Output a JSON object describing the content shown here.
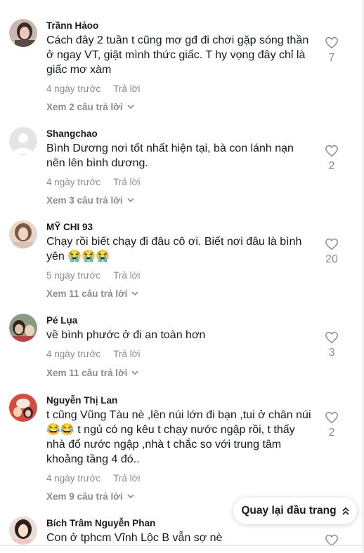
{
  "comments": [
    {
      "username": "Trầnn Hảoo",
      "text": "Cách đây 2 tuần t cũng mơ gđ đi chơi gặp sóng thần ở ngay VT, giật mình thức giấc. T hy vọng đây chỉ là giấc mơ xàm",
      "time": "4 ngày trước",
      "reply": "Trả lời",
      "view_replies": "Xem 2 câu trả lời",
      "likes": "7"
    },
    {
      "username": "Shangchao",
      "text": "Bình Dương nơi tốt nhất hiện tại, bà con lánh nạn nên lên bình dương.",
      "time": "4 ngày trước",
      "reply": "Trả lời",
      "view_replies": "Xem 3 câu trả lời",
      "likes": "2"
    },
    {
      "username": "MỸ CHI 93",
      "text": "Chạy rồi biết chạy đi đâu cô ơi. Biết nơi đâu là bình yên 😭😭😭",
      "time": "5 ngày trước",
      "reply": "Trả lời",
      "view_replies": "Xem 11 câu trả lời",
      "likes": "20"
    },
    {
      "username": "Pé Lụa",
      "text": "về bình phước ở đi an toàn hơn",
      "time": "4 ngày trước",
      "reply": "Trả lời",
      "view_replies": "Xem 11 câu trả lời",
      "likes": "3"
    },
    {
      "username": "Nguyễn Thị Lan",
      "text": "t cũng Vũng Tàu nè ,lên núi lớn đi bạn ,tui ở chân núi 😂😂 t ngủ có ng kêu t chạy nước ngập rồi, t thấy nhà đổ nước ngập ,nhà t chắc so với trung tâm khoảng tầng 4 đó..",
      "time": "4 ngày trước",
      "reply": "Trả lời",
      "view_replies": "Xem 9 câu trả lời",
      "likes": "2"
    },
    {
      "username": "Bích Trâm Nguyễn Phan",
      "text": "Con ở tphcm Vĩnh Lộc B vẫn sợ nè",
      "time": "",
      "reply": "",
      "view_replies": "",
      "likes": ""
    }
  ],
  "back_to_top": "Quay lại đầu trang",
  "icons": {
    "like": "heart-outline-icon",
    "expand": "chevron-down-icon",
    "back_to_top": "double-chevron-up-icon"
  },
  "colors": {
    "text": "#161823",
    "muted": "#8a8b91"
  }
}
